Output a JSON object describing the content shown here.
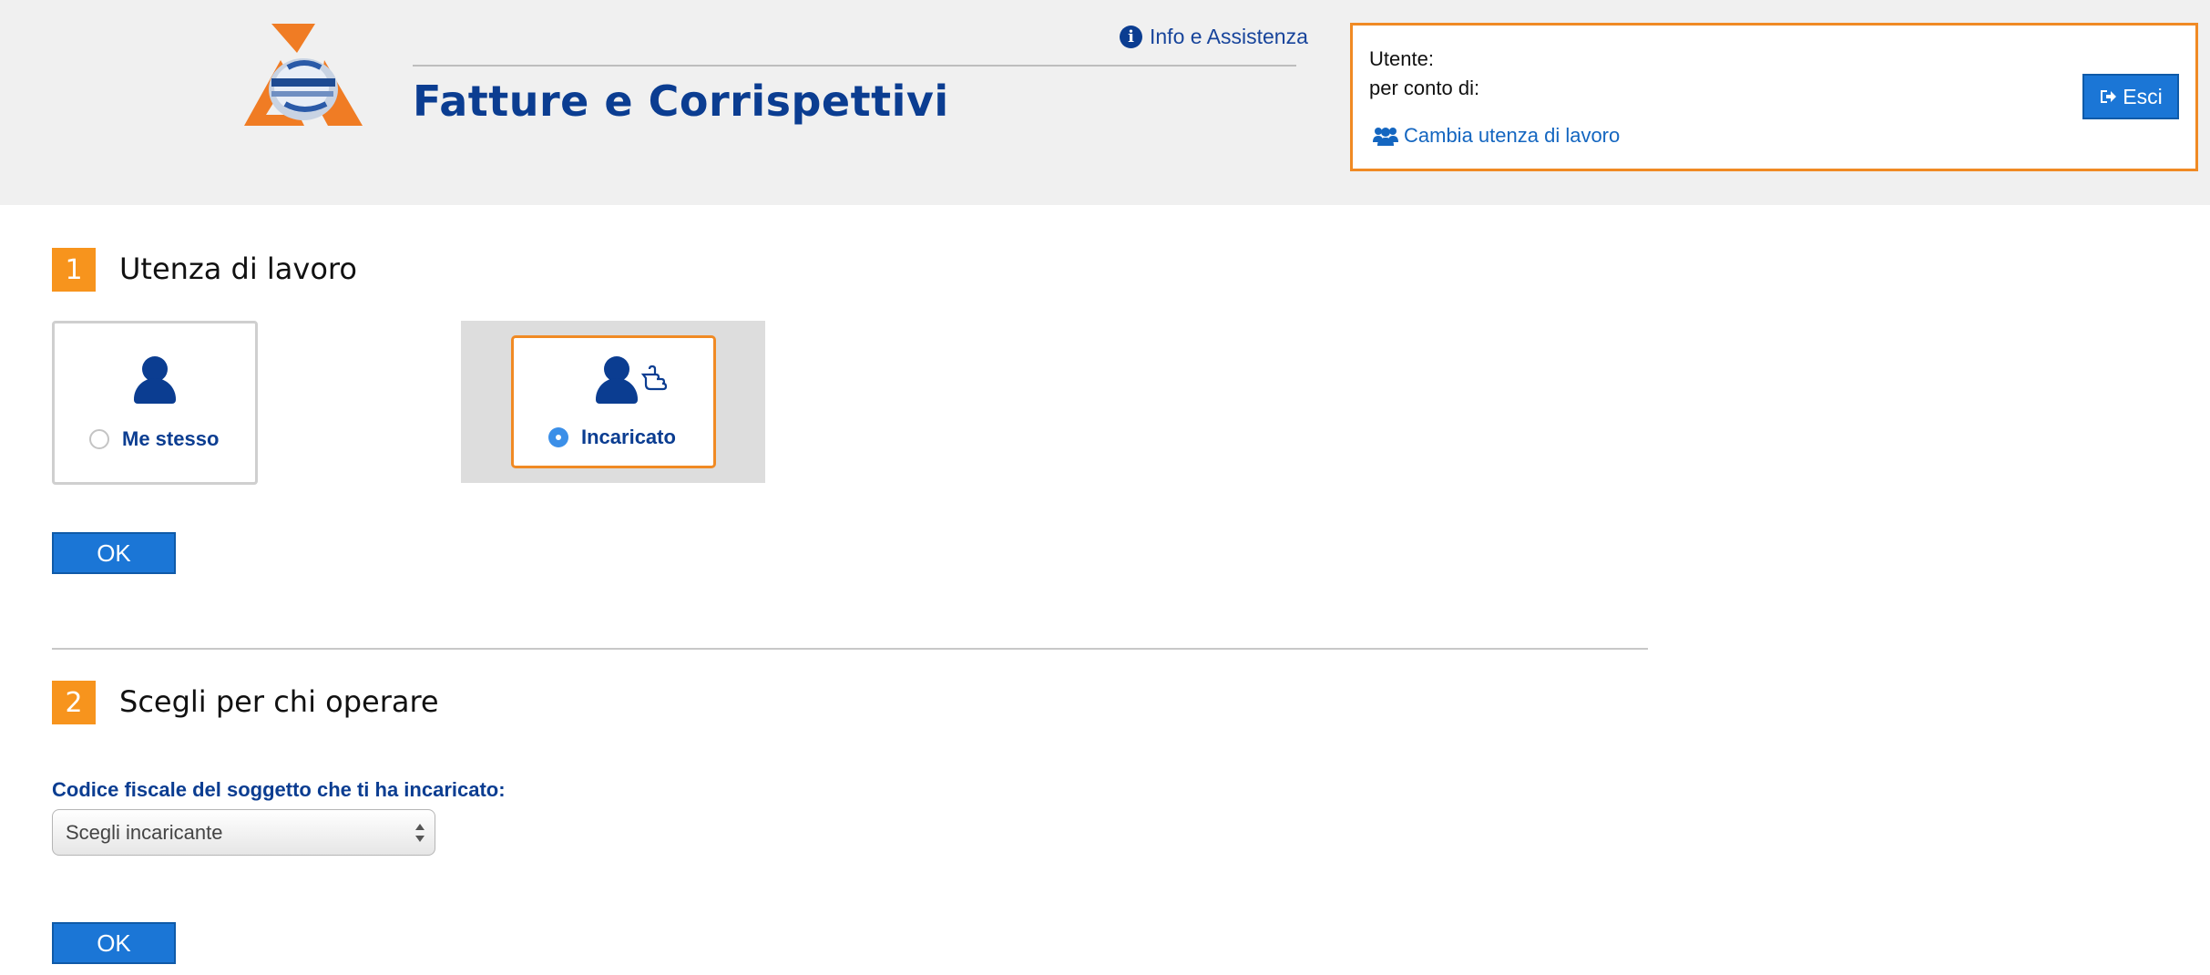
{
  "header": {
    "title": "Fatture e Corrispettivi",
    "info_link": "Info e Assistenza",
    "logo_icon": "agenzia-entrate-logo",
    "user_box": {
      "utente_label": "Utente:",
      "per_conto_label": "per conto di:",
      "cambia_link": "Cambia utenza di lavoro",
      "logout_label": "Esci"
    }
  },
  "step1": {
    "number": "1",
    "title": "Utenza di lavoro",
    "options": [
      {
        "label": "Me stesso",
        "selected": false,
        "icon": "person-icon"
      },
      {
        "label": "Incaricato",
        "selected": true,
        "icon": "person-pointing-icon"
      }
    ],
    "ok_label": "OK"
  },
  "step2": {
    "number": "2",
    "title": "Scegli per chi operare",
    "field_label": "Codice fiscale del soggetto che ti ha incaricato:",
    "select_value": "Scegli incaricante",
    "ok_label": "OK"
  },
  "colors": {
    "brand_blue": "#0b3d91",
    "button_blue": "#1b76d6",
    "accent_orange": "#f7941d",
    "header_bg": "#f0f0f0"
  }
}
